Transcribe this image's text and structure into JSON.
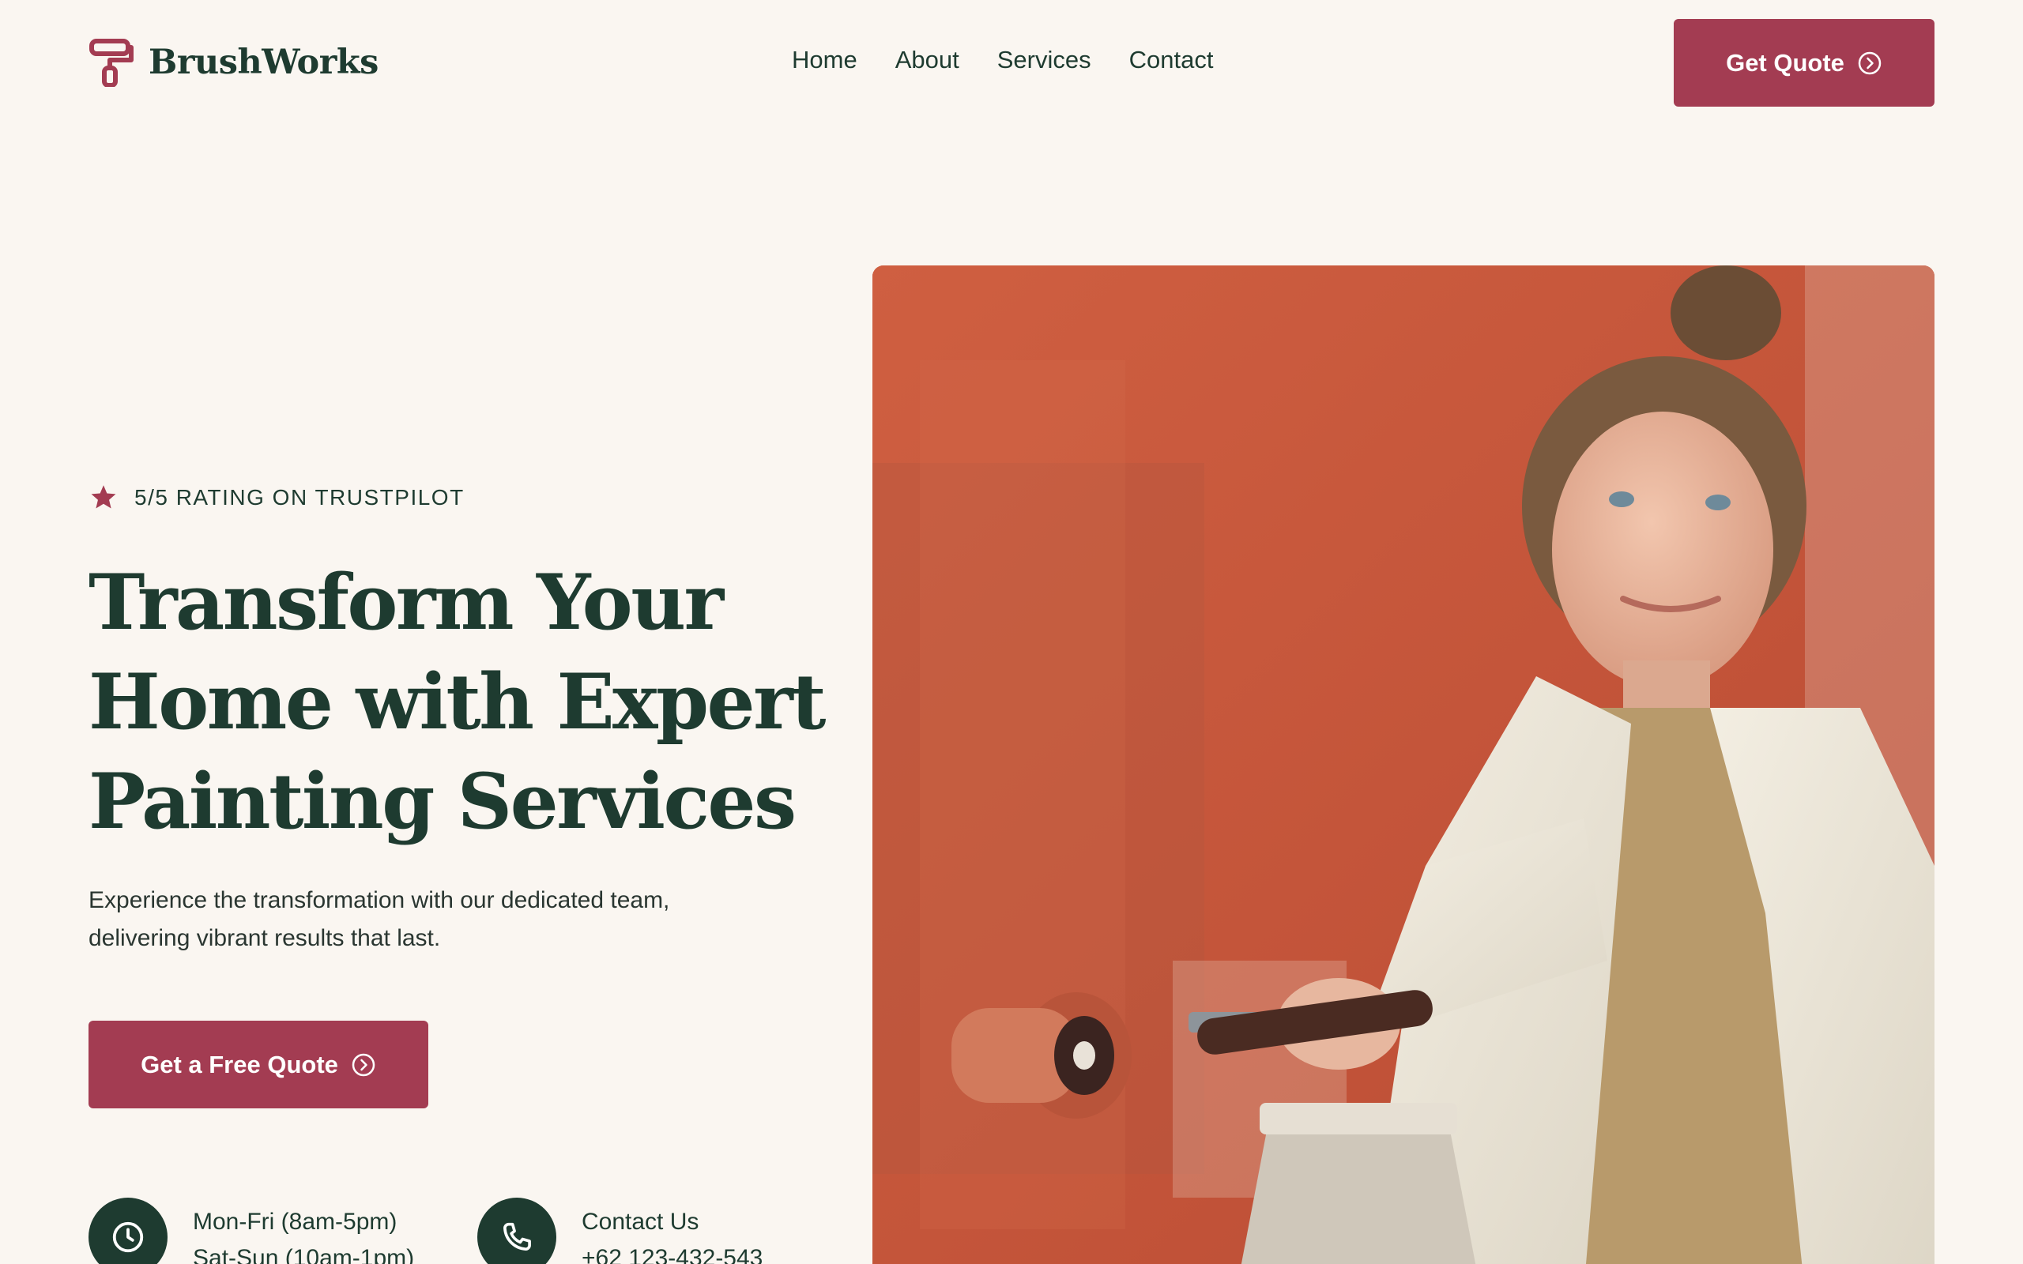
{
  "header": {
    "brand": "BrushWorks",
    "nav": [
      "Home",
      "About",
      "Services",
      "Contact"
    ],
    "cta_label": "Get Quote"
  },
  "hero": {
    "rating_text": "5/5 RATING ON TRUSTPILOT",
    "headline": [
      "Transform Your",
      "Home with Expert",
      "Painting Services"
    ],
    "subtext": [
      "Experience the transformation with our dedicated team,",
      "delivering vibrant results that last."
    ],
    "cta_label": "Get a Free Quote"
  },
  "info": {
    "hours": [
      "Mon-Fri (8am-5pm)",
      "Sat-Sun (10am-1pm)"
    ],
    "contact": [
      "Contact Us",
      "+62 123-432-543"
    ]
  },
  "icons": {
    "logo": "paint-roller-icon",
    "rating": "star-icon",
    "cta": "chevron-circle-right-icon",
    "hours": "clock-icon",
    "contact": "phone-icon"
  },
  "colors": {
    "background": "#faf6f1",
    "primary_text": "#1e3b30",
    "accent": "#a33c52",
    "icon_circle": "#1e3b30"
  }
}
